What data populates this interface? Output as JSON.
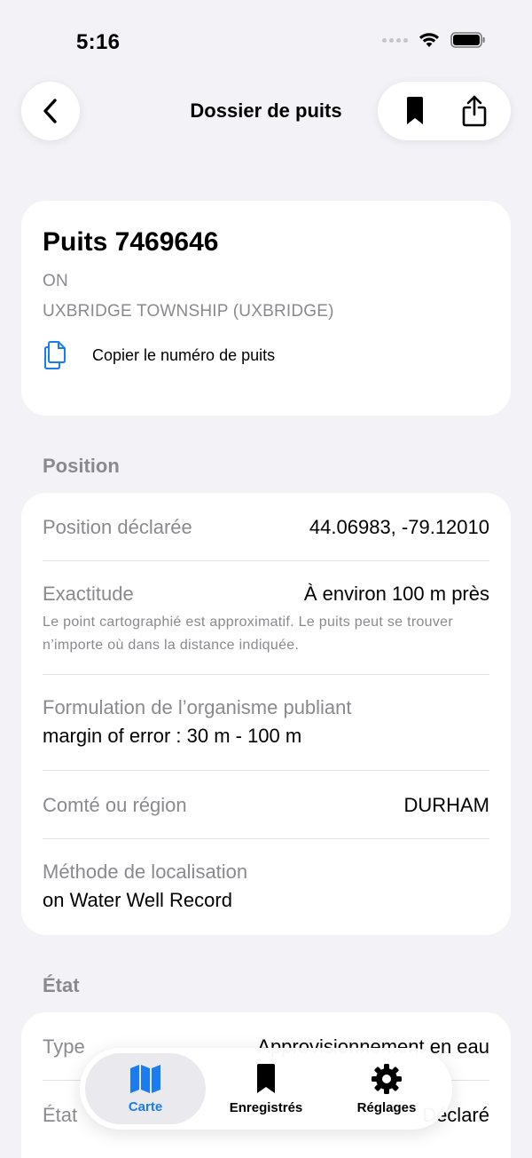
{
  "status_bar": {
    "time": "5:16"
  },
  "nav": {
    "title": "Dossier de puits"
  },
  "header": {
    "title": "Puits 7469646",
    "province": "ON",
    "township": "UXBRIDGE TOWNSHIP (UXBRIDGE)",
    "copy_label": "Copier le numéro de puits"
  },
  "position": {
    "section_title": "Position",
    "rows": [
      {
        "key": "Position déclarée",
        "value": "44.06983, -79.12010"
      },
      {
        "key": "Exactitude",
        "value": "À environ 100 m près",
        "note": "Le point cartographié est approximatif. Le puits peut se trouver n’importe où dans la distance indiquée."
      },
      {
        "key": "Formulation de l’organisme publiant",
        "value": "margin of error : 30 m - 100 m"
      },
      {
        "key": "Comté ou région",
        "value": "DURHAM"
      },
      {
        "key": "Méthode de localisation",
        "value": "on Water Well Record"
      }
    ]
  },
  "etat": {
    "section_title": "État",
    "rows": [
      {
        "key": "Type",
        "value": "Approvisionnement en eau"
      },
      {
        "key": "État",
        "value": "Déclaré"
      }
    ]
  },
  "tabs": [
    {
      "label": "Carte",
      "active": true
    },
    {
      "label": "Enregistrés",
      "active": false
    },
    {
      "label": "Réglages",
      "active": false
    }
  ],
  "colors": {
    "accent": "#1a7cf0",
    "background": "#f2f2f7",
    "secondary_text": "#8a8a8e"
  }
}
